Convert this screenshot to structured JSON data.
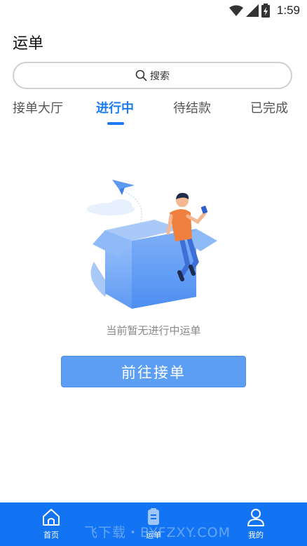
{
  "status_bar": {
    "time": "1:59"
  },
  "page": {
    "title": "运单"
  },
  "search": {
    "label": "搜索"
  },
  "tabs": [
    {
      "label": "接单大厅",
      "active": false
    },
    {
      "label": "进行中",
      "active": true
    },
    {
      "label": "待结款",
      "active": false
    },
    {
      "label": "已完成",
      "active": false
    }
  ],
  "empty_state": {
    "message": "当前暂无进行中运单",
    "button_label": "前往接单"
  },
  "bottom_nav": [
    {
      "label": "首页",
      "icon": "home-icon"
    },
    {
      "label": "运单",
      "icon": "waybill-icon",
      "active": true
    },
    {
      "label": "我的",
      "icon": "user-icon"
    }
  ],
  "watermark": "飞下载・BYFZXY.COM",
  "colors": {
    "accent": "#1d7bf0",
    "nav_bg": "#1274f3",
    "button": "#5b9ef4"
  }
}
